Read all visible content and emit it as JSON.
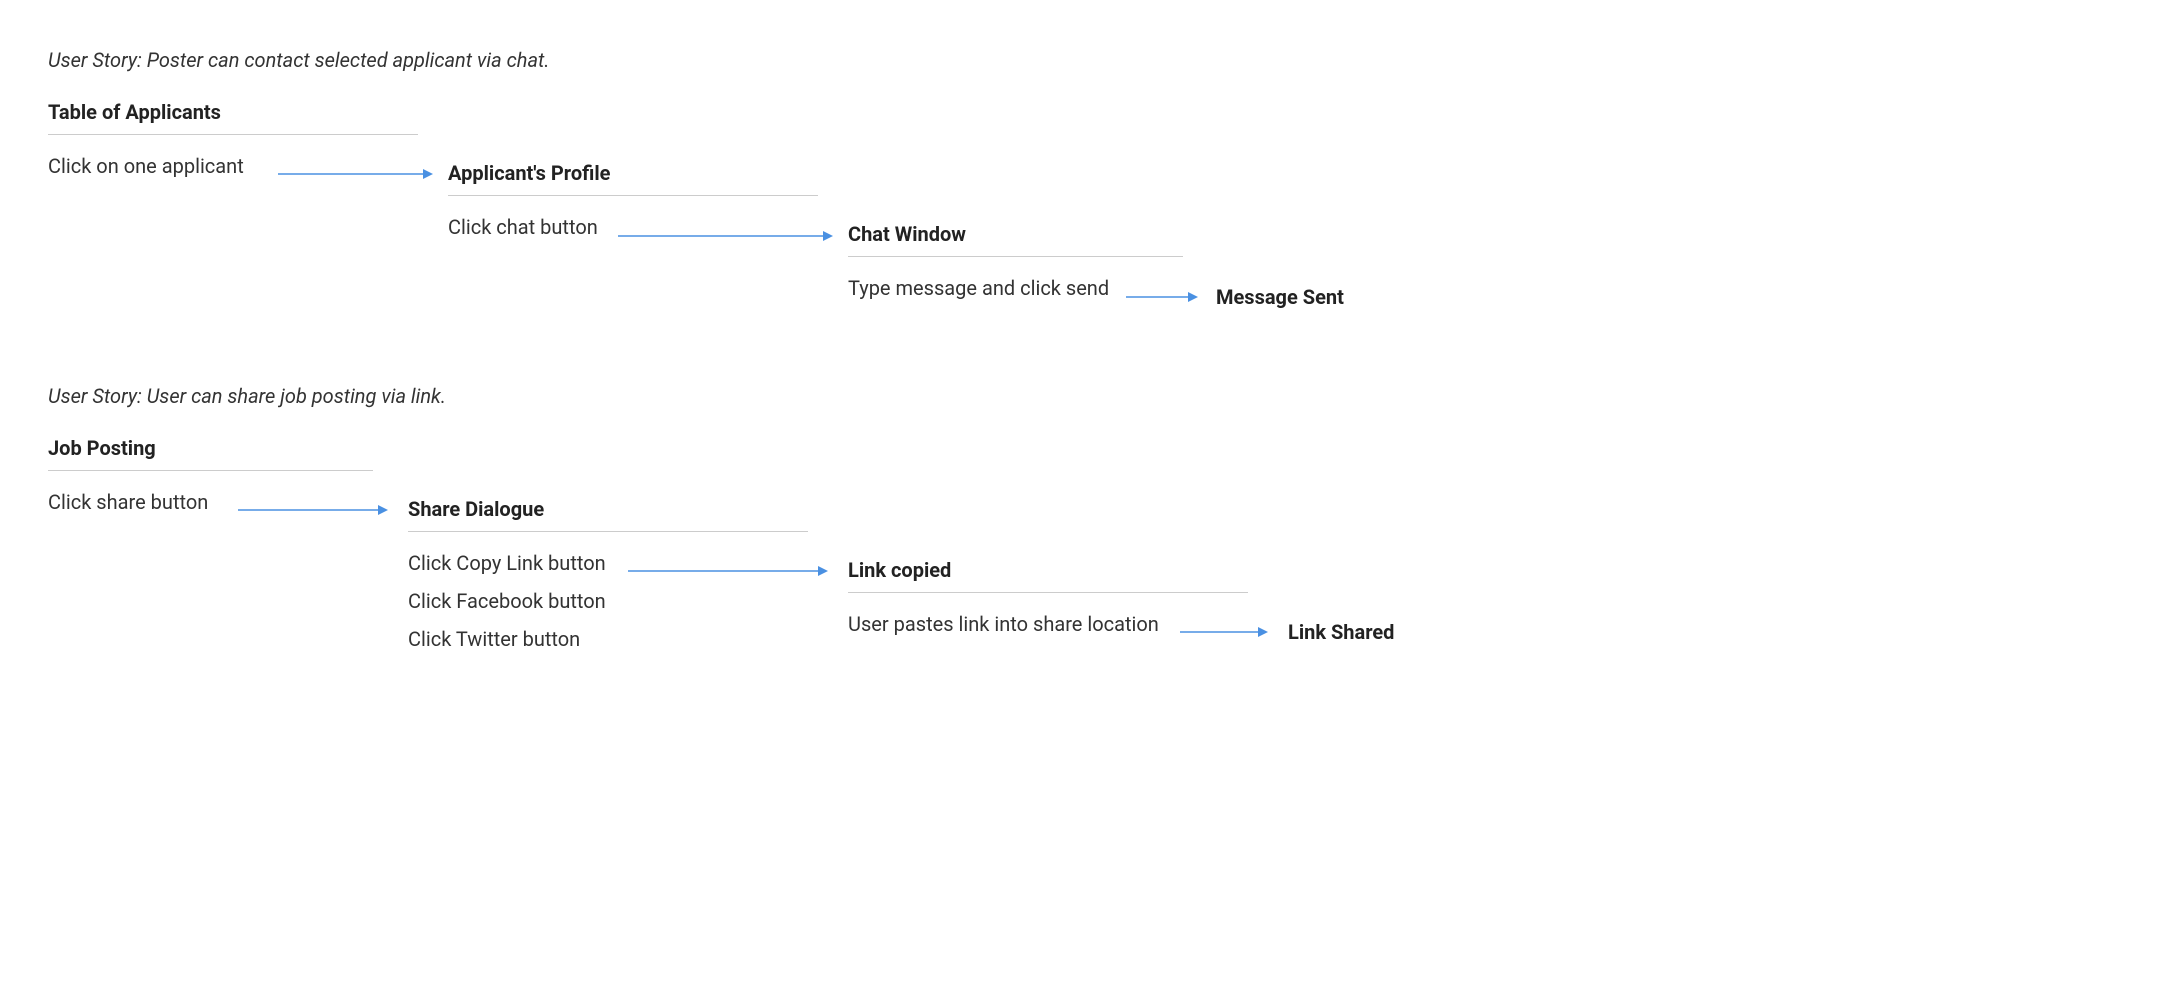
{
  "stories": [
    {
      "title": "User Story: Poster can contact selected applicant via chat.",
      "steps": [
        {
          "title": "Table of Applicants",
          "actions": [
            "Click on one applicant"
          ]
        },
        {
          "title": "Applicant's Profile",
          "actions": [
            "Click chat button"
          ]
        },
        {
          "title": "Chat Window",
          "actions": [
            "Type message and click send"
          ]
        }
      ],
      "result": "Message Sent"
    },
    {
      "title": "User Story: User can share job posting via link.",
      "steps": [
        {
          "title": "Job Posting",
          "actions": [
            "Click share button"
          ]
        },
        {
          "title": "Share Dialogue",
          "actions": [
            "Click Copy Link button",
            "Click Facebook button",
            "Click Twitter button"
          ]
        },
        {
          "title": "Link copied",
          "actions": [
            "User pastes link into share location"
          ]
        }
      ],
      "result": "Link Shared"
    }
  ]
}
